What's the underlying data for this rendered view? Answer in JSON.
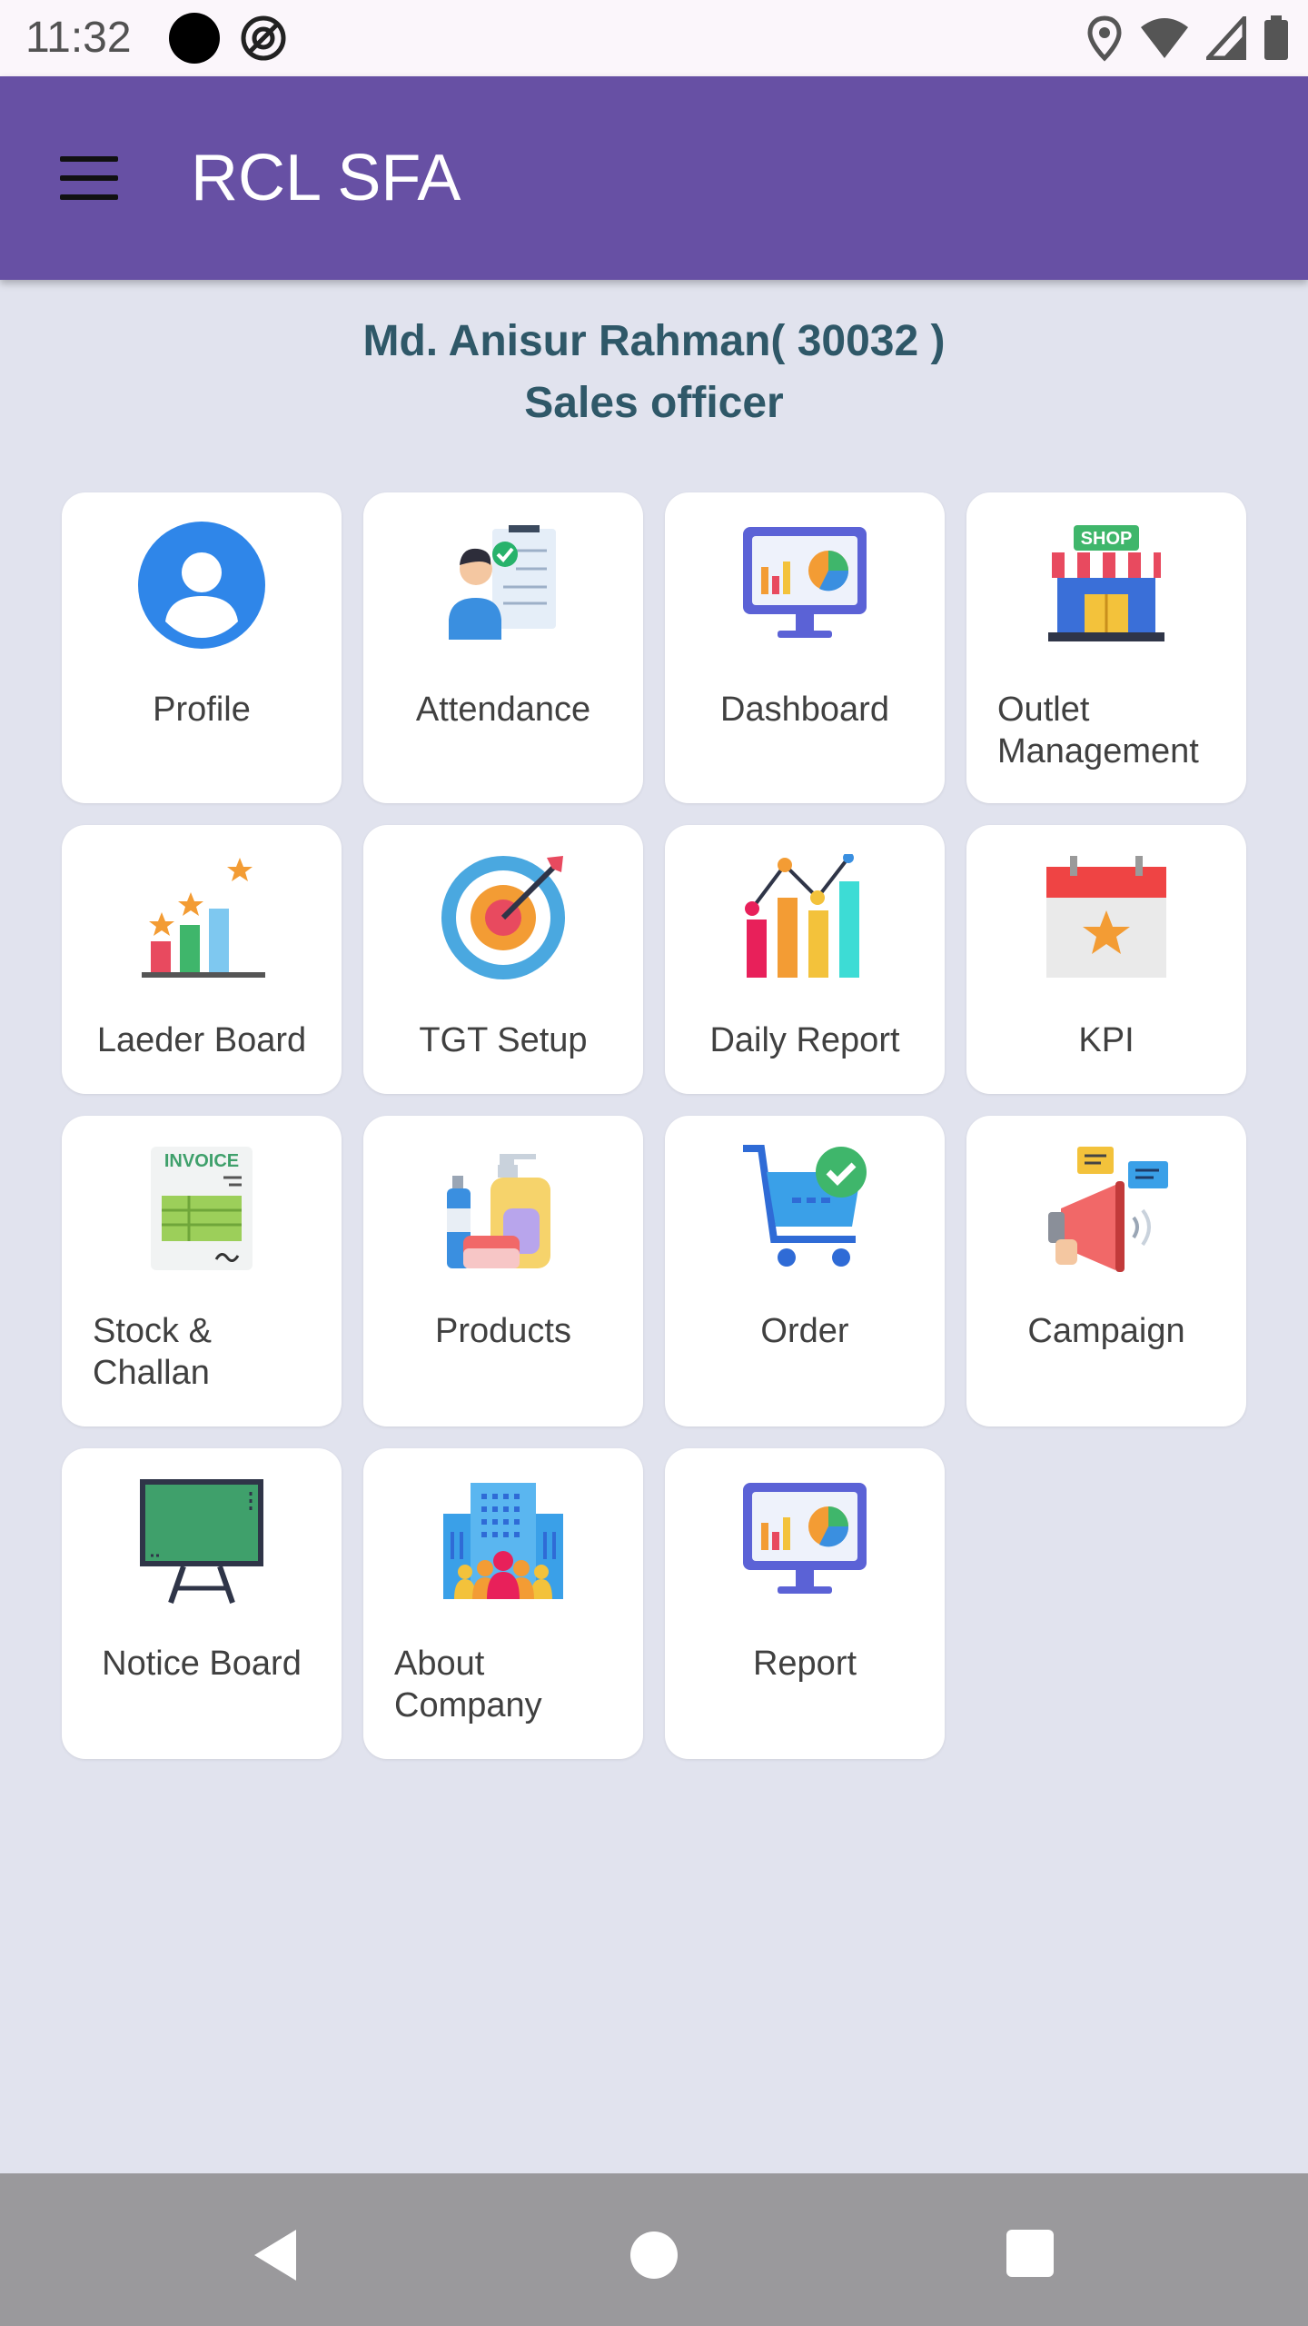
{
  "status_bar": {
    "time": "11:32"
  },
  "app_bar": {
    "title": "RCL SFA"
  },
  "user": {
    "name_line": "Md. Anisur Rahman( 30032 )",
    "role": "Sales officer"
  },
  "tiles": [
    {
      "label": "Profile",
      "icon": "profile-icon"
    },
    {
      "label": "Attendance",
      "icon": "attendance-icon"
    },
    {
      "label": "Dashboard",
      "icon": "dashboard-icon"
    },
    {
      "label": "Outlet Management",
      "icon": "shop-icon"
    },
    {
      "label": "Laeder Board",
      "icon": "leaderboard-icon"
    },
    {
      "label": "TGT Setup",
      "icon": "target-icon"
    },
    {
      "label": "Daily Report",
      "icon": "daily-report-icon"
    },
    {
      "label": "KPI",
      "icon": "calendar-star-icon"
    },
    {
      "label": "Stock & Challan",
      "icon": "invoice-icon"
    },
    {
      "label": "Products",
      "icon": "products-icon"
    },
    {
      "label": "Order",
      "icon": "cart-icon"
    },
    {
      "label": "Campaign",
      "icon": "megaphone-icon"
    },
    {
      "label": "Notice Board",
      "icon": "chalkboard-icon"
    },
    {
      "label": "About Company",
      "icon": "company-building-icon"
    },
    {
      "label": "Report",
      "icon": "report-icon"
    }
  ],
  "icon_text": {
    "shop_sign": "SHOP",
    "invoice_header": "INVOICE"
  },
  "colors": {
    "app_bar": "#6750a4",
    "background": "#e1e3ee",
    "user_text": "#2f5868"
  }
}
